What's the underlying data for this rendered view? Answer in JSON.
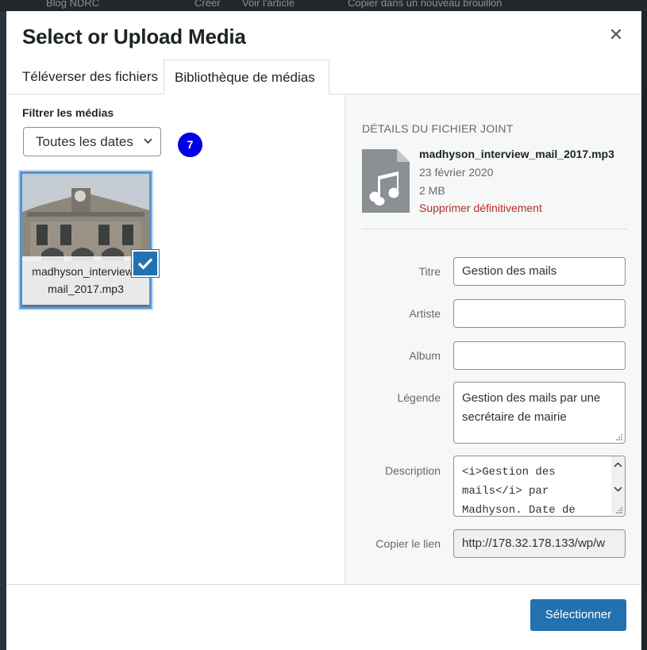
{
  "admin_bar": {
    "site": "Blog NDRC",
    "create": "Créer",
    "view": "Voir l'article",
    "copy": "Copier dans un nouveau brouillon"
  },
  "modal": {
    "title": "Select or Upload Media",
    "close_icon": "close-icon",
    "tabs": [
      {
        "label": "Téléverser des fichiers",
        "active": false
      },
      {
        "label": "Bibliothèque de médias",
        "active": true
      }
    ]
  },
  "browser": {
    "filter_label": "Filtrer les médias",
    "date_filter": {
      "selected": "Toutes les dates"
    },
    "badge": "7",
    "attachments": [
      {
        "filename": "madhyson_interview_mail_2017.mp3",
        "selected": true
      }
    ]
  },
  "details": {
    "heading": "DÉTAILS DU FICHIER JOINT",
    "file_icon": "audio-file-icon",
    "filename": "madhyson_interview_mail_2017.mp3",
    "date": "23 février 2020",
    "size": "2 MB",
    "delete_label": "Supprimer définitivement",
    "fields": {
      "title": {
        "label": "Titre",
        "value": "Gestion des mails"
      },
      "artist": {
        "label": "Artiste",
        "value": ""
      },
      "album": {
        "label": "Album",
        "value": ""
      },
      "caption": {
        "label": "Légende",
        "value": "Gestion des mails par une secrétaire de mairie"
      },
      "description": {
        "label": "Description",
        "value": "<i>Gestion des mails</i> par Madhyson. Date de"
      },
      "copy_link": {
        "label": "Copier le lien",
        "value": "http://178.32.178.133/wp/w"
      }
    }
  },
  "footer": {
    "select_label": "Sélectionner"
  },
  "colors": {
    "primary": "#2271b1",
    "delete": "#b32d2e",
    "badge": "#0000e6"
  }
}
